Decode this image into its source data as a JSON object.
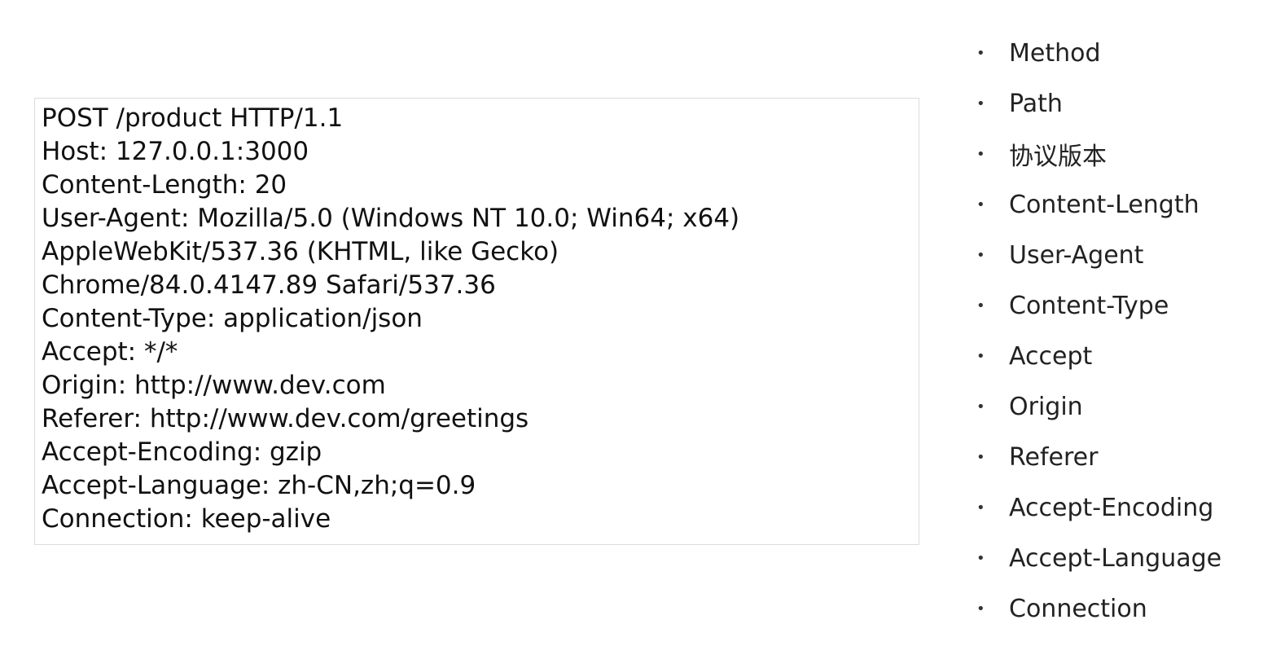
{
  "request": {
    "lines": [
      "POST /product HTTP/1.1",
      "Host: 127.0.0.1:3000",
      "Content-Length: 20",
      "User-Agent: Mozilla/5.0 (Windows NT 10.0; Win64; x64)",
      "AppleWebKit/537.36 (KHTML, like Gecko)",
      "Chrome/84.0.4147.89 Safari/537.36",
      "Content-Type: application/json",
      "Accept: */*",
      "Origin: http://www.dev.com",
      "Referer: http://www.dev.com/greetings",
      "Accept-Encoding: gzip",
      "Accept-Language: zh-CN,zh;q=0.9",
      "Connection: keep-alive"
    ]
  },
  "fields": {
    "bullet": "•",
    "items": [
      "Method",
      "Path",
      "协议版本",
      "Content-Length",
      "User-Agent",
      "Content-Type",
      "Accept",
      "Origin",
      "Referer",
      "Accept-Encoding",
      "Accept-Language",
      "Connection"
    ]
  }
}
